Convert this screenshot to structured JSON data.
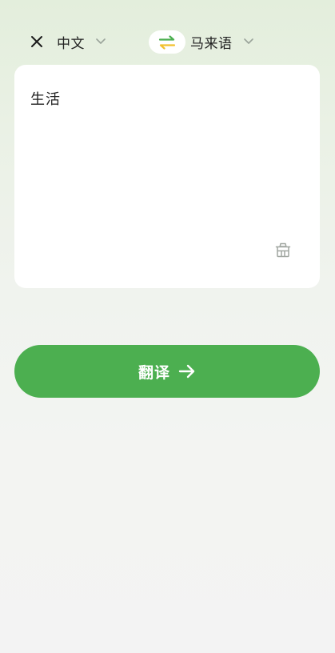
{
  "header": {
    "close_icon": "close-icon",
    "source_language": "中文",
    "target_language": "马来语",
    "swap_icon": "swap-arrows-icon",
    "chevron_icon": "chevron-down-icon",
    "swap_colors": [
      "#4caf50",
      "#f2c12e"
    ]
  },
  "input": {
    "text": "生活",
    "clear_icon": "clear-basket-icon"
  },
  "translate_button": {
    "label": "翻译",
    "icon": "arrow-right-icon",
    "color": "#4caf50"
  }
}
